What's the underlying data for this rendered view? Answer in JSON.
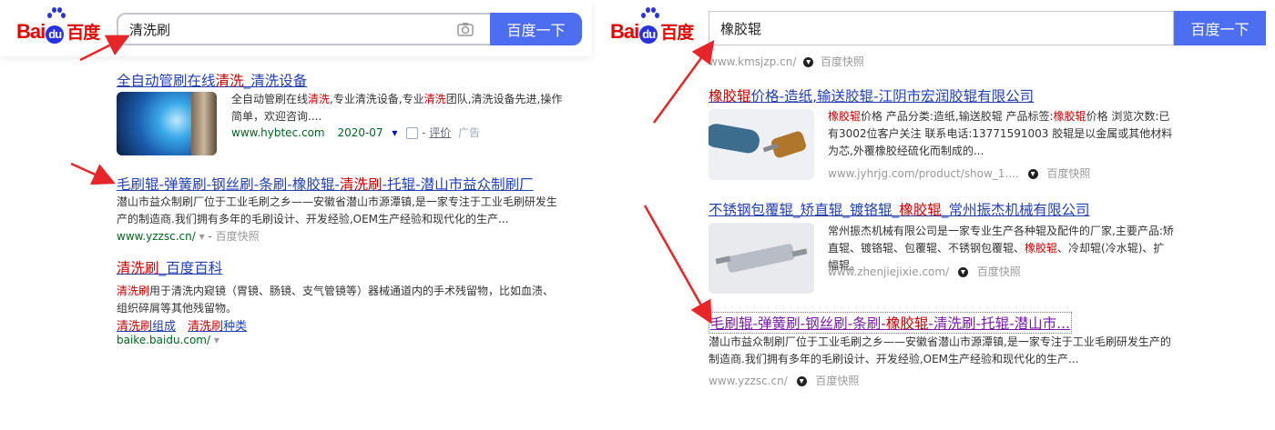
{
  "left": {
    "logo": {
      "bai": "Bai",
      "du": "du",
      "cn": "百度"
    },
    "search": {
      "query": "清洗刷",
      "button": "百度一下"
    },
    "results": [
      {
        "title_parts": [
          "全自动管刷在线",
          "清洗",
          "_清洗设备"
        ],
        "snippet_parts": [
          "全自动管刷在线",
          "清洗",
          ",专业清洗设备,专业",
          "清洗",
          "团队,清洗设备先进,操作简单，欢迎咨询...."
        ],
        "url": "www.hybtec.com",
        "date": "2020-07",
        "eval": "评价",
        "ad": "广告"
      },
      {
        "title_parts": [
          "毛刷辊-弹簧刷-钢丝刷-条刷-橡胶辊-",
          "清洗刷",
          "-托辊-潜山市益众制刷厂"
        ],
        "snippet": "潜山市益众制刷厂位于工业毛刷之乡——安徽省潜山市源潭镇,是一家专注于工业毛刷研发生产的制造商.我们拥有多年的毛刷设计、开发经验,OEM生产经验和现代化的生产...",
        "url": "www.yzzsc.cn/",
        "snapshot": "百度快照"
      },
      {
        "title_parts": [
          "清洗刷",
          "_百度百科"
        ],
        "snippet_parts": [
          "清洗刷",
          "用于清洗内窥镜（胃镜、肠镜、支气管镜等）器械通道内的手术残留物，比如血渍、组织碎屑等其他残留物。"
        ],
        "sublinks": [
          [
            "清洗刷",
            "组成"
          ],
          [
            "清洗刷",
            "种类"
          ]
        ],
        "url": "baike.baidu.com/"
      }
    ]
  },
  "right": {
    "logo": {
      "bai": "Bai",
      "du": "du",
      "cn": "百度"
    },
    "search": {
      "query": "橡胶辊",
      "button": "百度一下"
    },
    "top_url": "www.kmsjzp.cn/",
    "top_snapshot": "百度快照",
    "results": [
      {
        "title_parts": [
          "橡胶辊",
          "价格-造纸,输送胶辊-江阴市宏润胶辊有限公司"
        ],
        "snippet_parts": [
          "橡胶辊",
          "价格 产品分类:造纸,输送胶辊 产品标签:",
          "橡胶辊",
          "价格 浏览次数:已有3002位客户关注 联系电话:13771591003 胶辊是以金属或其他材料为芯,外覆橡胶经硫化而制成的..."
        ],
        "url": "www.jyhrjg.com/product/show_1....",
        "snapshot": "百度快照"
      },
      {
        "title_parts": [
          "不锈钢包覆辊_矫直辊_镀铬辊_",
          "橡胶辊",
          "_常州振杰机械有限公司"
        ],
        "snippet_parts": [
          "常州振杰机械有限公司是一家专业生产各种辊及配件的厂家,主要产品:矫直辊、镀铬辊、包覆辊、不锈钢包覆辊、",
          "橡胶辊",
          "、冷却辊(冷水辊)、扩幅辊。"
        ],
        "url": "www.zhenjiejixie.com/",
        "snapshot": "百度快照"
      },
      {
        "title_parts": [
          "毛刷辊-弹簧刷-钢丝刷-条刷-",
          "橡胶辊",
          "-清洗刷-托辊-潜山市..."
        ],
        "snippet": "潜山市益众制刷厂位于工业毛刷之乡——安徽省潜山市源潭镇,是一家专注于工业毛刷研发生产的制造商.我们拥有多年的毛刷设计、开发经验,OEM生产经验和现代化的生产...",
        "url": "www.yzzsc.cn/",
        "snapshot": "百度快照"
      }
    ]
  },
  "colors": {
    "brand_red": "#e10602",
    "brand_blue": "#2932e1",
    "button_blue": "#4e6ef2",
    "link": "#2440b3",
    "green_url": "#006621",
    "arrow": "#e8262a"
  }
}
